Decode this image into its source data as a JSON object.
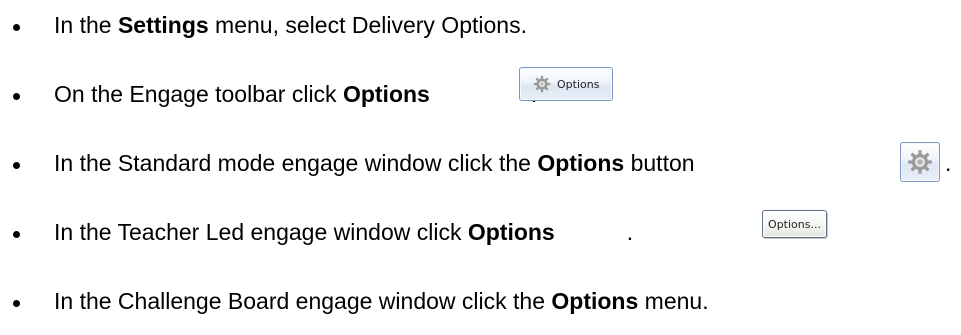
{
  "items": [
    {
      "before": "In the ",
      "bold": "Settings",
      "after": " menu, select Delivery Options."
    },
    {
      "before": "On the Engage toolbar click ",
      "bold": "Options",
      "after": "."
    },
    {
      "before": "In the Standard mode engage window click the ",
      "bold": "Options",
      "after": " button",
      "trail": "."
    },
    {
      "before": "In the Teacher Led engage window click ",
      "bold": "Options",
      "after": "."
    },
    {
      "before": "In the Challenge Board engage window click the ",
      "bold": "Options",
      "after": " menu."
    }
  ],
  "buttons": {
    "toolbar_options_label": "Options",
    "toolbar_options_icon": "gear-icon",
    "standard_options_icon": "gear-icon",
    "teacher_options_label": "Options..."
  },
  "colors": {
    "text": "#000000",
    "button_border": "#7a98c0",
    "gear": "#8a8a8a"
  }
}
